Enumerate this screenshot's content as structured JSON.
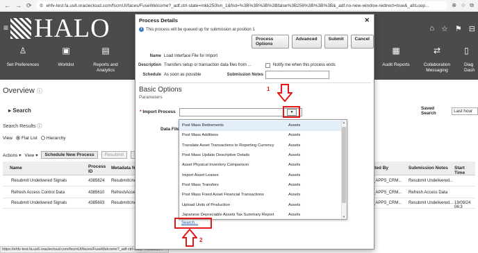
{
  "browser": {
    "url": "ehfv-test.fa.us6.oraclecloud.com/fscmUI/faces/FuseWelcome?_adf.ctrl-state=mkk250lvn_1&fnd=%3B%3B%3B%3Bfalse%3B256%3B%3B%3B&_adf.no-new-window-redirect=true&_afrLoop..."
  },
  "app": {
    "logo_text": "HALO",
    "springboard": [
      {
        "label": "Set Preferences",
        "icon": "person-gear-icon"
      },
      {
        "label": "Worklist",
        "icon": "clipboard-icon"
      },
      {
        "label": "Reports and Analytics",
        "icon": "chart-icon"
      },
      {
        "label": "Audit Reports",
        "icon": "audit-icon"
      },
      {
        "label": "Collaboration Messaging",
        "icon": "arrows-icon"
      },
      {
        "label": "Diag Dash",
        "icon": "doc-icon"
      }
    ],
    "overview": "Overview",
    "search": "Search",
    "search_results": "Search Results",
    "view_label": "View",
    "flat_list": "Flat List",
    "hierarchy": "Hierarchy",
    "actions": "Actions",
    "view": "View",
    "schedule_new_process": "Schedule New Process",
    "resubmit": "Resubmit",
    "put": "Put",
    "saved_search_label": "Saved Search",
    "saved_search_value": "Last hour",
    "columns": {
      "name": "Name",
      "process_id": "Process ID",
      "metadata": "Metadata N",
      "submitted_by": "tted By",
      "submission_notes": "Submission Notes",
      "start_time": "Start Time"
    },
    "rows": [
      {
        "name": "Resubmit Undelivered Signals",
        "id": "4385624",
        "meta": "ResubmitUnd",
        "by": "_APPS_CRM...",
        "notes": "Resubmit Undelivered...",
        "start": ""
      },
      {
        "name": "Refresh Access Control Data",
        "id": "4385610",
        "meta": "RefreshAcce",
        "by": "_APPS_CRM...",
        "notes": "Refresh Access Data",
        "start": ""
      },
      {
        "name": "Resubmit Undelivered Signals",
        "id": "4385603",
        "meta": "ResubmitUnd",
        "by": "_APPS_CRM...",
        "notes": "Resubmit Undelivered...",
        "start": "19/09/24 06:3"
      }
    ],
    "status_url": "https://ehfv-test.fa.us6.oraclecloud.com/fscmUI/faces/FuseWelcome?_adf.ctrl-state=mkk250l..."
  },
  "dialog": {
    "title": "Process Details",
    "info": "This process will be queued up for submission at position 1",
    "buttons": {
      "process_options": "Process Options",
      "advanced": "Advanced",
      "submit": "Submit",
      "cancel": "Cancel"
    },
    "fields": {
      "name_label": "Name",
      "name_value": "Load Interface File for Import",
      "description_label": "Description",
      "description_value": "Transfers setup or transaction data files from ...",
      "notify_label": "Notify me when this process ends",
      "schedule_label": "Schedule",
      "schedule_value": "As soon as possible",
      "submission_notes_label": "Submission Notes"
    },
    "basic_options": "Basic Options",
    "parameters": "Parameters",
    "import_process_label": "Import Process",
    "data_file_label": "Data File",
    "dropdown_items": [
      {
        "name": "Post Mass Retirements",
        "category": "Assets"
      },
      {
        "name": "Post Mass Additions",
        "category": "Assets"
      },
      {
        "name": "Translate Asset Transactions to Reporting Currency",
        "category": "Assets"
      },
      {
        "name": "Post Mass Update Descriptive Details",
        "category": "Assets"
      },
      {
        "name": "Asset Physical Inventory Comparison",
        "category": "Assets"
      },
      {
        "name": "Import Asset Leases",
        "category": "Assets"
      },
      {
        "name": "Post Mass Transfers",
        "category": "Assets"
      },
      {
        "name": "Post Mass Fixed Asset Financial Transactions",
        "category": "Assets"
      },
      {
        "name": "Upload Units of Production",
        "category": "Assets"
      },
      {
        "name": "Japanese Depreciable Assets Tax Summary Report",
        "category": "Assets"
      }
    ],
    "search_link": "Search..."
  },
  "annotations": {
    "step1": "1",
    "step2": "2",
    "highlight_color": "#e01818"
  }
}
